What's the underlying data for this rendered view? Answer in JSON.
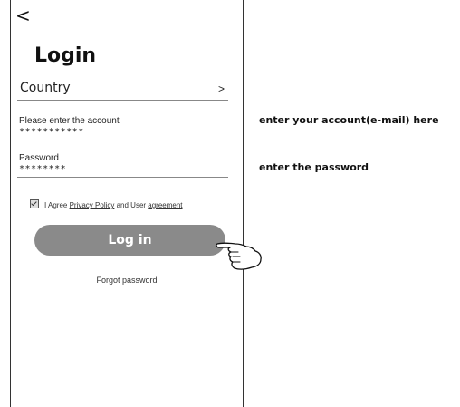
{
  "screen": {
    "back_symbol": "<",
    "title": "Login"
  },
  "country": {
    "label": "Country",
    "chevron": ">"
  },
  "account_field": {
    "label": "Please enter the account",
    "value": "***********"
  },
  "password_field": {
    "label": "Password",
    "value": "********"
  },
  "agreement": {
    "checked": true,
    "prefix": "I Agree ",
    "privacy_link": "Privacy Policy",
    "middle": " and User ",
    "agreement_link": "agreement"
  },
  "login_button": {
    "label": "Log in"
  },
  "forgot_link": {
    "label": "Forgot password"
  },
  "annotations": {
    "account": "enter your account(e-mail) here",
    "password": "enter the password"
  },
  "icons": {
    "hand": "pointing-hand-icon",
    "checkbox": "checkbox-checked-icon"
  },
  "colors": {
    "button_bg": "#8a8a8a",
    "button_text": "#ffffff"
  }
}
